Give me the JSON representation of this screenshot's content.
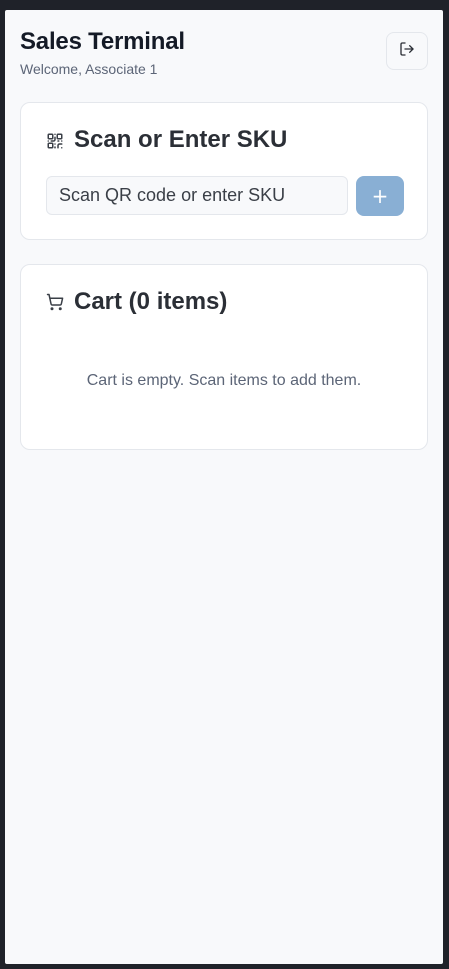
{
  "header": {
    "title": "Sales Terminal",
    "subtitle": "Welcome, Associate 1",
    "logout_icon": "logout-icon"
  },
  "scan": {
    "title": "Scan or Enter SKU",
    "icon": "qr-code-icon",
    "input_value": "",
    "placeholder": "Scan QR code or enter SKU",
    "add_label": "+"
  },
  "cart": {
    "title": "Cart (0 items)",
    "icon": "cart-icon",
    "empty_message": "Cart is empty. Scan items to add them."
  },
  "colors": {
    "background": "#f8f9fb",
    "card": "#ffffff",
    "accent_button_disabled": "#89afd4",
    "text_primary": "#141a26",
    "text_muted": "#5c6577"
  }
}
